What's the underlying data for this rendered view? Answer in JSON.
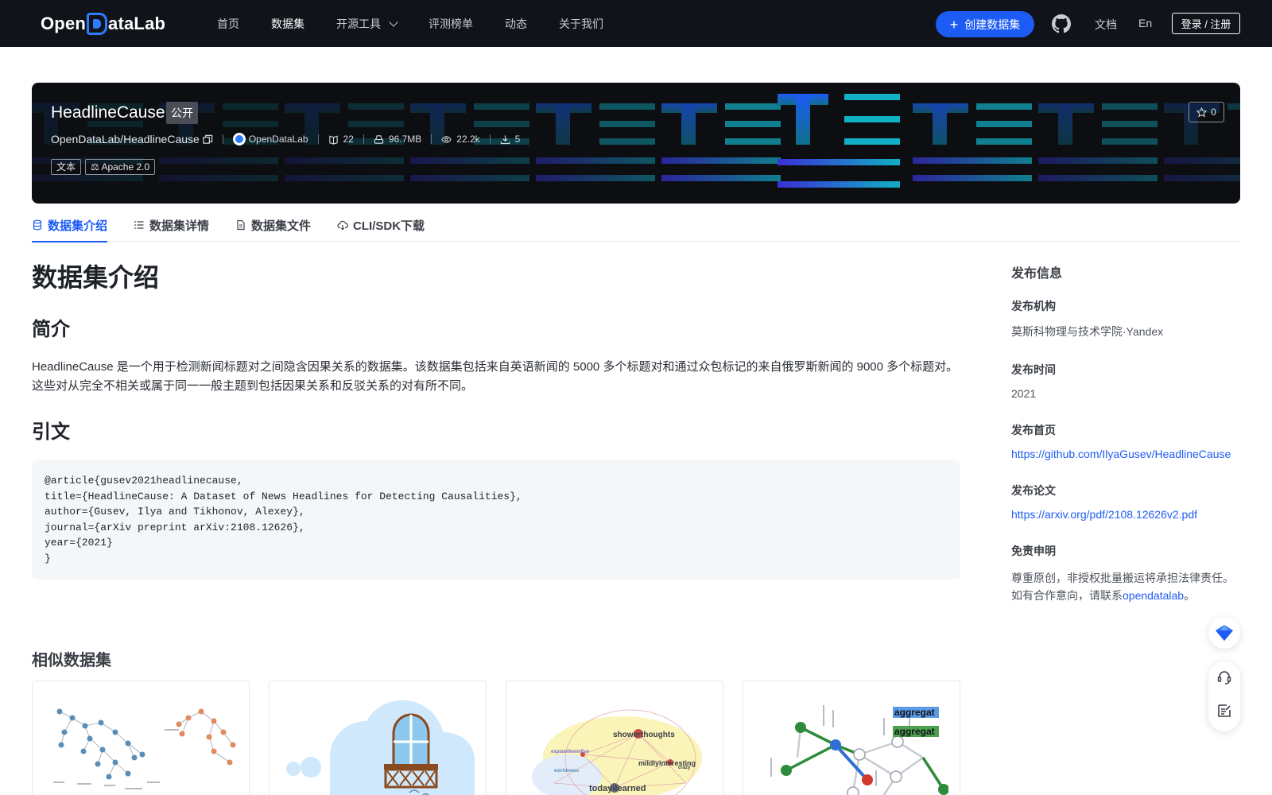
{
  "nav": {
    "logo_text_left": "Open",
    "logo_text_right": "ataLab",
    "items": [
      {
        "label": "首页",
        "active": false
      },
      {
        "label": "数据集",
        "active": true
      },
      {
        "label": "开源工具",
        "active": false,
        "has_dropdown": true
      },
      {
        "label": "评测榜单",
        "active": false
      },
      {
        "label": "动态",
        "active": false
      },
      {
        "label": "关于我们",
        "active": false
      }
    ],
    "create_label": "创建数据集",
    "docs_label": "文档",
    "lang_label": "En",
    "login_label": "登录 / 注册",
    "github_icon": "github-icon",
    "accent": "#1d5bf5"
  },
  "dataset": {
    "name": "HeadlineCause",
    "visibility": "公开",
    "path": "OpenDataLab/HeadlineCause",
    "org": "OpenDataLab",
    "files": "22",
    "size": "96.7MB",
    "views": "22.2k",
    "downloads": "5",
    "tags": [
      "文本",
      "Apache 2.0"
    ],
    "stars": "0"
  },
  "tabs": [
    {
      "label": "数据集介绍",
      "active": true,
      "icon": "database-icon"
    },
    {
      "label": "数据集详情",
      "active": false,
      "icon": "list-icon"
    },
    {
      "label": "数据集文件",
      "active": false,
      "icon": "file-icon"
    },
    {
      "label": "CLI/SDK下载",
      "active": false,
      "icon": "cloud-download-icon"
    }
  ],
  "intro": {
    "title": "数据集介绍",
    "summary_heading": "简介",
    "summary": "HeadlineCause 是一个用于检测新闻标题对之间隐含因果关系的数据集。该数据集包括来自英语新闻的 5000 多个标题对和通过众包标记的来自俄罗斯新闻的 9000 多个标题对。这些对从完全不相关或属于同一一般主题到包括因果关系和反驳关系的对有所不同。",
    "citation_heading": "引文",
    "citation": "@article{gusev2021headlinecause,\ntitle={HeadlineCause: A Dataset of News Headlines for Detecting Causalities},\nauthor={Gusev, Ilya and Tikhonov, Alexey},\njournal={arXiv preprint arXiv:2108.12626},\nyear={2021}\n}"
  },
  "sidebar": {
    "title": "发布信息",
    "org_label": "发布机构",
    "org_value": "莫斯科物理与技术学院·Yandex",
    "time_label": "发布时间",
    "time_value": "2021",
    "homepage_label": "发布首页",
    "homepage_value": "https://github.com/IlyaGusev/HeadlineCause",
    "paper_label": "发布论文",
    "paper_value": "https://arxiv.org/pdf/2108.12626v2.pdf",
    "disclaimer_label": "免责申明",
    "disclaimer_line1": "尊重原创，非授权批量搬运将承担法律责任。",
    "disclaimer_line2_prefix": "如有合作意向，请联系",
    "disclaimer_link": "opendatalab",
    "disclaimer_suffix": "。"
  },
  "similar": {
    "title": "相似数据集",
    "cards": [
      {
        "thumb": "tree-diagram-thumbnail"
      },
      {
        "thumb": "cloud-window-thumbnail"
      },
      {
        "thumb": "word-graph-thumbnail",
        "labels": [
          "showerthoughts",
          "mildlyinteresting",
          "todayilearned",
          "explainlikeimfive",
          "crazy",
          "worldnews"
        ]
      },
      {
        "thumb": "network-graph-thumbnail",
        "labels": [
          "aggregat",
          "aggregat"
        ]
      }
    ]
  },
  "floating": {
    "icons": [
      "diamond-logo-icon",
      "headset-icon",
      "feedback-icon"
    ]
  }
}
